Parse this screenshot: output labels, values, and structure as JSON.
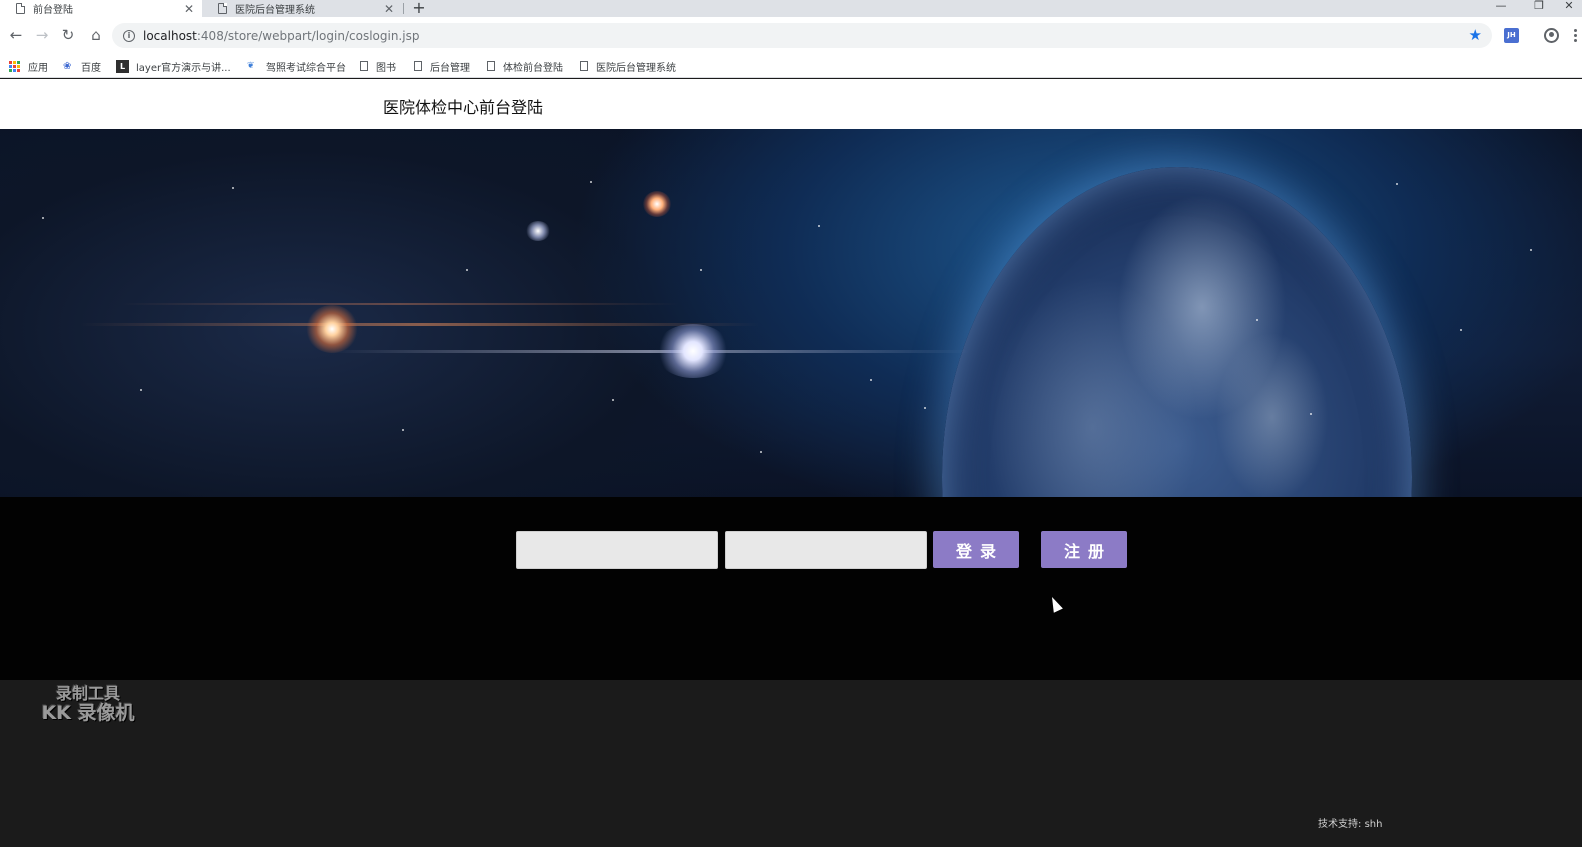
{
  "browser": {
    "tabs": [
      {
        "title": "前台登陆",
        "active": true
      },
      {
        "title": "医院后台管理系统",
        "active": false
      }
    ],
    "new_tab_symbol": "+",
    "address": {
      "host": "localhost",
      "path": ":408/store/webpart/login/coslogin.jsp"
    },
    "extension_badge": "JH",
    "bookmarks": [
      {
        "label": "应用",
        "icon": "apps-grid-icon"
      },
      {
        "label": "百度",
        "icon": "baidu-paw-icon"
      },
      {
        "label": "layer官方演示与讲...",
        "icon": "layer-logo-icon"
      },
      {
        "label": "驾照考试综合平台",
        "icon": "hawk-logo-icon"
      },
      {
        "label": "图书",
        "icon": "page-icon"
      },
      {
        "label": "后台管理",
        "icon": "page-icon"
      },
      {
        "label": "体检前台登陆",
        "icon": "page-icon"
      },
      {
        "label": "医院后台管理系统",
        "icon": "page-icon"
      }
    ],
    "window_controls": [
      "—",
      "❐",
      "✕"
    ]
  },
  "page": {
    "title": "医院体检中心前台登陆",
    "login": {
      "username_value": "",
      "password_value": "",
      "login_label": "登录",
      "register_label": "注册",
      "button_color": "#8c7bc6"
    },
    "footer": {
      "support_label": "技术支持:",
      "support_name": "shh"
    }
  },
  "overlay": {
    "watermark_line1": "录制工具",
    "watermark_line2": "KK 录像机"
  }
}
